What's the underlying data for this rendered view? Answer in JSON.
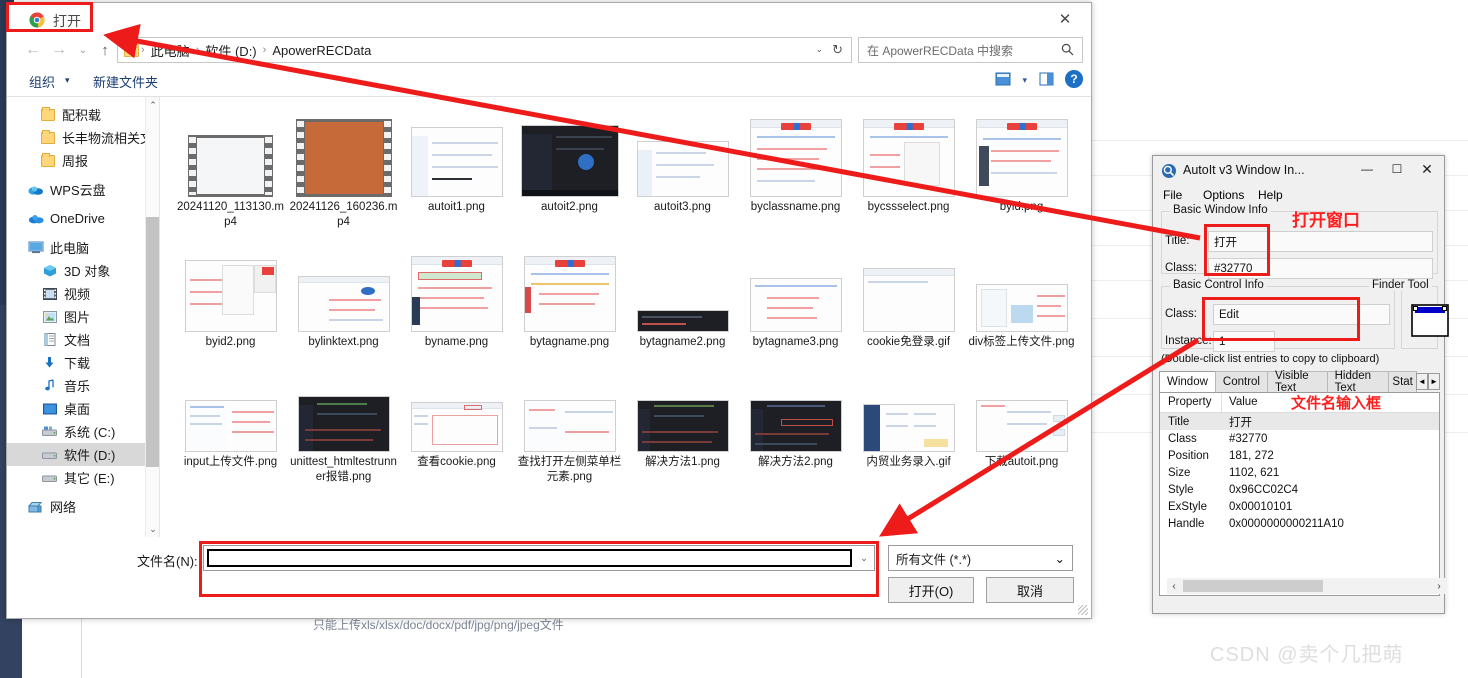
{
  "background": {
    "note": "只能上传xls/xlsx/doc/docx/pdf/jpg/png/jpeg文件",
    "watermark": "CSDN @卖个几把萌"
  },
  "dialog": {
    "title": "打开",
    "icon": "chrome-icon",
    "close_label": "✕",
    "nav": {
      "back": "←",
      "forward": "→",
      "recent": "⌄",
      "up": "↑"
    },
    "address": {
      "crumbs": [
        "此电脑",
        "软件 (D:)",
        "ApowerRECData"
      ],
      "separator": "›",
      "caret": "⌄",
      "refresh": "↻"
    },
    "search": {
      "placeholder": "在 ApowerRECData 中搜索",
      "icon": "search-icon"
    },
    "toolbar": {
      "organize": "组织",
      "organize_caret": "▾",
      "new_folder": "新建文件夹",
      "view_caret": "▾",
      "help": "?"
    },
    "sidebar": {
      "items": [
        {
          "label": "配积载",
          "icon": "folder-icon",
          "selected": false
        },
        {
          "label": "长丰物流相关文",
          "icon": "folder-icon",
          "selected": false
        },
        {
          "label": "周报",
          "icon": "folder-icon",
          "selected": false
        },
        {
          "label": "WPS云盘",
          "icon": "cloud-icon",
          "selected": false
        },
        {
          "label": "OneDrive",
          "icon": "onedrive-icon",
          "selected": false
        },
        {
          "label": "此电脑",
          "icon": "pc-icon",
          "selected": false
        },
        {
          "label": "3D 对象",
          "icon": "3d-icon",
          "selected": false
        },
        {
          "label": "视频",
          "icon": "video-icon",
          "selected": false
        },
        {
          "label": "图片",
          "icon": "picture-icon",
          "selected": false
        },
        {
          "label": "文档",
          "icon": "document-icon",
          "selected": false
        },
        {
          "label": "下载",
          "icon": "download-icon",
          "selected": false
        },
        {
          "label": "音乐",
          "icon": "music-icon",
          "selected": false
        },
        {
          "label": "桌面",
          "icon": "desktop-icon",
          "selected": false
        },
        {
          "label": "系统 (C:)",
          "icon": "drive-icon",
          "selected": false
        },
        {
          "label": "软件 (D:)",
          "icon": "drive-icon",
          "selected": true
        },
        {
          "label": "其它 (E:)",
          "icon": "drive-icon",
          "selected": false
        },
        {
          "label": "网络",
          "icon": "network-icon",
          "selected": false
        }
      ],
      "scroll_up": "⌃",
      "scroll_down": "⌄"
    },
    "files": [
      {
        "name": "20241120_113130.mp4",
        "kind": "video"
      },
      {
        "name": "20241126_160236.mp4",
        "kind": "video"
      },
      {
        "name": "autoit1.png",
        "kind": "shot-white"
      },
      {
        "name": "autoit2.png",
        "kind": "shot-dark"
      },
      {
        "name": "autoit3.png",
        "kind": "shot-white"
      },
      {
        "name": "byclassname.png",
        "kind": "shot-baidu"
      },
      {
        "name": "bycssselect.png",
        "kind": "shot-baidu"
      },
      {
        "name": "byid.png",
        "kind": "shot-baidu"
      },
      {
        "name": "byid2.png",
        "kind": "shot-white"
      },
      {
        "name": "bylinktext.png",
        "kind": "shot-white"
      },
      {
        "name": "byname.png",
        "kind": "shot-baidu"
      },
      {
        "name": "bytagname.png",
        "kind": "shot-baidu"
      },
      {
        "name": "bytagname2.png",
        "kind": "shot-dark"
      },
      {
        "name": "bytagname3.png",
        "kind": "shot-white"
      },
      {
        "name": "cookie免登录.gif",
        "kind": "shot-blank"
      },
      {
        "name": "div标签上传文件.png",
        "kind": "shot-white"
      },
      {
        "name": "input上传文件.png",
        "kind": "shot-white"
      },
      {
        "name": "unittest_htmltestrunner报错.png",
        "kind": "shot-dark"
      },
      {
        "name": "查看cookie.png",
        "kind": "shot-white"
      },
      {
        "name": "查找打开左侧菜单栏元素.png",
        "kind": "shot-white"
      },
      {
        "name": "解决方法1.png",
        "kind": "shot-dark"
      },
      {
        "name": "解决方法2.png",
        "kind": "shot-dark"
      },
      {
        "name": "内贸业务录入.gif",
        "kind": "shot-white"
      },
      {
        "name": "下载autoit.png",
        "kind": "shot-white"
      }
    ],
    "bottom": {
      "filename_label": "文件名(N):",
      "filename_value": "",
      "filename_caret": "⌄",
      "filter_value": "所有文件 (*.*)",
      "filter_caret": "⌄",
      "open_button": "打开(O)",
      "cancel_button": "取消"
    }
  },
  "autoit": {
    "title": "AutoIt v3 Window In...",
    "icon": "autoit-icon",
    "minimize": "—",
    "maximize": "☐",
    "close": "✕",
    "menus": [
      "File",
      "Options",
      "Help"
    ],
    "basic_window_info": {
      "legend": "Basic Window Info",
      "title_label": "Title:",
      "title_value": "打开",
      "class_label": "Class:",
      "class_value": "#32770"
    },
    "basic_control_info": {
      "legend": "Basic Control Info",
      "class_label": "Class:",
      "class_value": "Edit",
      "instance_label": "Instance:",
      "instance_value": "1"
    },
    "finder_tool": {
      "legend": "Finder Tool"
    },
    "hint": "(Double-click list entries to copy to clipboard)",
    "tabs": [
      "Window",
      "Control",
      "Visible Text",
      "Hidden Text",
      "Stat"
    ],
    "active_tab": "Window",
    "tab_prev": "◄",
    "tab_next": "►",
    "table": {
      "headers": [
        "Property",
        "Value"
      ],
      "rows": [
        {
          "property": "Title",
          "value": "打开"
        },
        {
          "property": "Class",
          "value": "#32770"
        },
        {
          "property": "Position",
          "value": "181, 272"
        },
        {
          "property": "Size",
          "value": "1102, 621"
        },
        {
          "property": "Style",
          "value": "0x96CC02C4"
        },
        {
          "property": "ExStyle",
          "value": "0x00010101"
        },
        {
          "property": "Handle",
          "value": "0x0000000000211A10"
        }
      ]
    },
    "hscroll_left": "‹",
    "hscroll_right": "›"
  },
  "annotations": {
    "open_window": "打开窗口",
    "filename_input": "文件名输入框",
    "accent_red": "#ee1b1b"
  }
}
